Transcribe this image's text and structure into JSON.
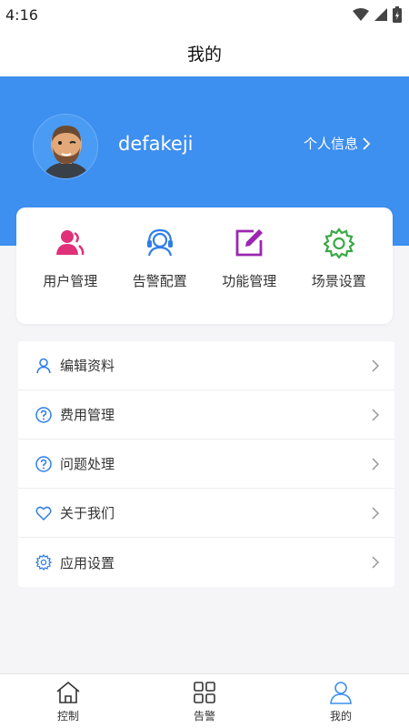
{
  "status": {
    "time": "4:16"
  },
  "header": {
    "title": "我的"
  },
  "profile": {
    "username": "defakeji",
    "link_label": "个人信息"
  },
  "quick_actions": [
    {
      "label": "用户管理",
      "icon": "user-manage-icon",
      "color": "#e0307a"
    },
    {
      "label": "告警配置",
      "icon": "headset-icon",
      "color": "#2f7ee8"
    },
    {
      "label": "功能管理",
      "icon": "edit-icon",
      "color": "#9b27b0"
    },
    {
      "label": "场景设置",
      "icon": "gear-icon",
      "color": "#3aa845"
    }
  ],
  "menu": [
    {
      "label": "编辑资料",
      "icon": "user-icon"
    },
    {
      "label": "费用管理",
      "icon": "question-icon"
    },
    {
      "label": "问题处理",
      "icon": "question-icon"
    },
    {
      "label": "关于我们",
      "icon": "heart-icon"
    },
    {
      "label": "应用设置",
      "icon": "gear-icon"
    }
  ],
  "tabs": [
    {
      "label": "控制",
      "icon": "home-icon",
      "active": false
    },
    {
      "label": "告警",
      "icon": "grid-icon",
      "active": false
    },
    {
      "label": "我的",
      "icon": "person-icon",
      "active": true
    }
  ],
  "colors": {
    "accent": "#3d8ff0",
    "menu_icon": "#2f7ee8",
    "active_tab": "#3d8ff0"
  }
}
